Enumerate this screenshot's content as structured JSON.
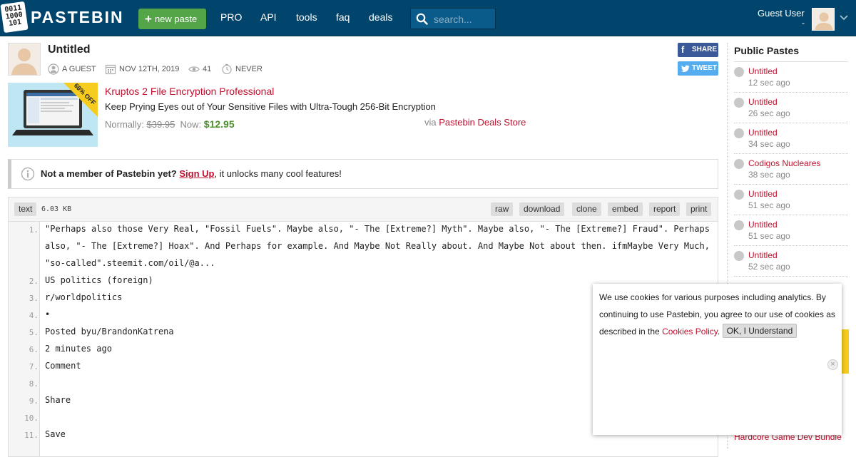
{
  "header": {
    "logo_digits": [
      "0011",
      "1000",
      "101"
    ],
    "logo_text": "PASTEBIN",
    "new_paste_label": "new paste",
    "nav": [
      "PRO",
      "API",
      "tools",
      "faq",
      "deals"
    ],
    "search_placeholder": "search...",
    "user_name": "Guest User",
    "user_sub": "-"
  },
  "paste": {
    "title": "Untitled",
    "author": "A GUEST",
    "date": "NOV 12TH, 2019",
    "views": "41",
    "expires": "NEVER",
    "share_label": "SHARE",
    "tweet_label": "TWEET"
  },
  "ad": {
    "badge": "68% OFF",
    "title": "Kruptos 2 File Encryption Professional",
    "subtitle": "Keep Prying Eyes out of Your Sensitive Files with Ultra-Tough 256-Bit Encryption",
    "normally_label": "Normally:",
    "old_price": "$39.95",
    "now_label": "Now:",
    "new_price": "$12.95",
    "via_label": "via",
    "store": "Pastebin Deals Store"
  },
  "notice": {
    "bold": "Not a member of Pastebin yet?",
    "link": "Sign Up",
    "rest": ", it unlocks many cool features!"
  },
  "code": {
    "format": "text",
    "size": "6.03 KB",
    "actions": [
      "raw",
      "download",
      "clone",
      "embed",
      "report",
      "print"
    ],
    "lines": [
      {
        "n": "1.",
        "text": "\"Perhaps also those Very Real, \"Fossil Fuels\". Maybe also, \"- The [Extreme?] Myth\". Maybe also, \"- The [Extreme?] Fraud\". Perhaps also, \"- The [Extreme?] Hoax\". And Perhaps for example. And Maybe Not Really about. And Maybe Not about then. ifmMaybe Very Much, \"so-called\".steemit.com/oil/@a..."
      },
      {
        "n": "2.",
        "text": "US politics (foreign)"
      },
      {
        "n": "3.",
        "text": "r/worldpolitics"
      },
      {
        "n": "4.",
        "text": "•"
      },
      {
        "n": "5.",
        "text": "Posted byu/BrandonKatrena"
      },
      {
        "n": "6.",
        "text": "2 minutes ago"
      },
      {
        "n": "7.",
        "text": "Comment"
      },
      {
        "n": "8.",
        "text": ""
      },
      {
        "n": "9.",
        "text": "Share"
      },
      {
        "n": "10.",
        "text": ""
      },
      {
        "n": "11.",
        "text": "Save"
      }
    ]
  },
  "sidebar": {
    "title": "Public Pastes",
    "items": [
      {
        "name": "Untitled",
        "ago": "12 sec ago"
      },
      {
        "name": "Untitled",
        "ago": "26 sec ago"
      },
      {
        "name": "Untitled",
        "ago": "34 sec ago"
      },
      {
        "name": "Codigos Nucleares",
        "ago": "38 sec ago"
      },
      {
        "name": "Untitled",
        "ago": "51 sec ago"
      },
      {
        "name": "Untitled",
        "ago": "51 sec ago"
      },
      {
        "name": "Untitled",
        "ago": "52 sec ago"
      }
    ],
    "ad_text": "Hardcore Game Dev Bundle"
  },
  "cookie": {
    "text": "We use cookies for various purposes including analytics. By continuing to use Pastebin, you agree to our use of cookies as described in the",
    "link": "Cookies Policy",
    "button": "OK, I Understand"
  },
  "colors": {
    "header_bg": "#02456c",
    "new_paste_green": "#53a548",
    "link_red": "#c0102e",
    "price_green": "#4d8f2d",
    "facebook": "#3b5998",
    "twitter": "#55acee"
  }
}
